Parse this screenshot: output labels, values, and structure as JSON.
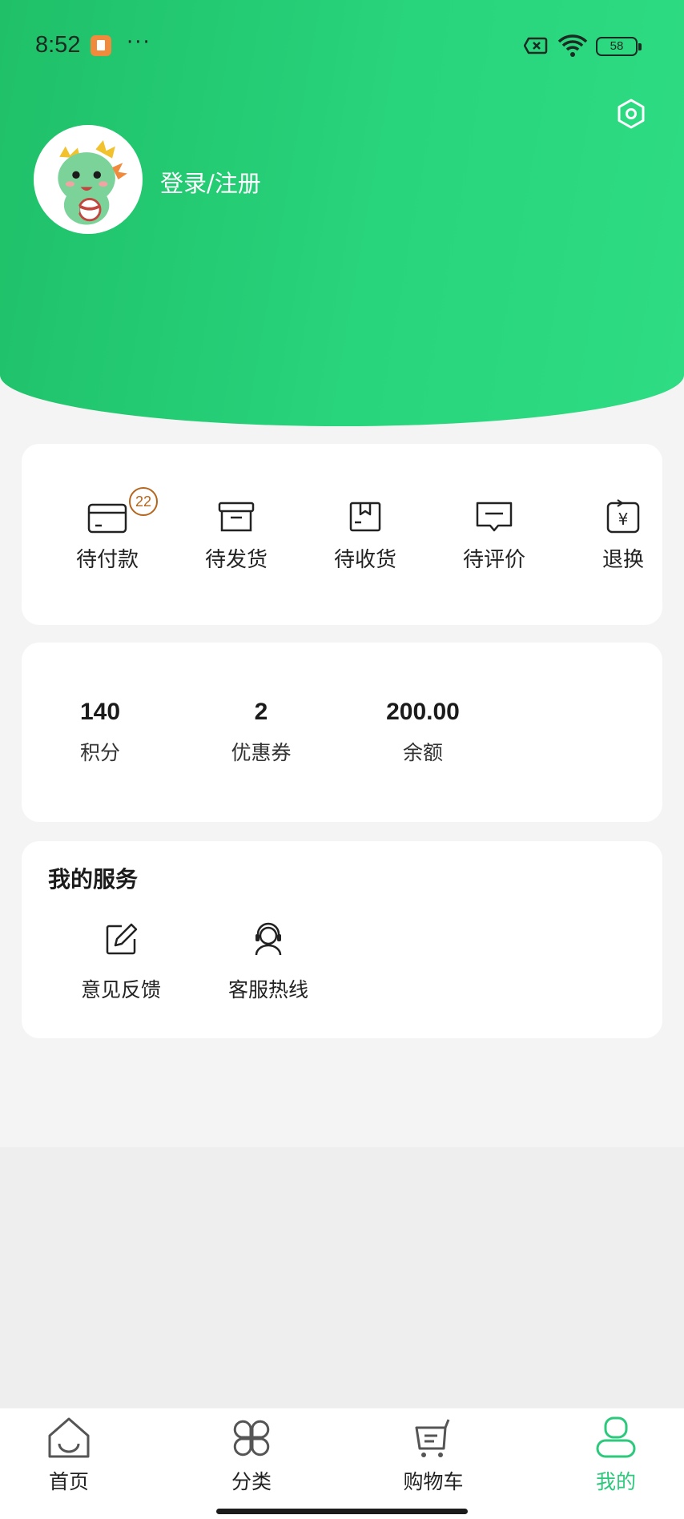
{
  "status_bar": {
    "time": "8:52",
    "dots": "···",
    "battery": "58"
  },
  "profile": {
    "login_label": "登录/注册"
  },
  "orders": [
    {
      "label": "待付款",
      "badge": "22"
    },
    {
      "label": "待发货"
    },
    {
      "label": "待收货"
    },
    {
      "label": "待评价"
    },
    {
      "label": "退换"
    }
  ],
  "assets": [
    {
      "value": "140",
      "label": "积分"
    },
    {
      "value": "2",
      "label": "优惠券"
    },
    {
      "value": "200.00",
      "label": "余额"
    }
  ],
  "services": {
    "title": "我的服务",
    "items": [
      {
        "label": "意见反馈",
        "icon": "edit-icon"
      },
      {
        "label": "客服热线",
        "icon": "customer-service-icon"
      }
    ]
  },
  "tabbar": {
    "items": [
      {
        "label": "首页",
        "icon": "home-icon"
      },
      {
        "label": "分类",
        "icon": "category-icon"
      },
      {
        "label": "购物车",
        "icon": "cart-icon"
      },
      {
        "label": "我的",
        "icon": "profile-icon",
        "active": true
      }
    ]
  },
  "colors": {
    "brand_green": "#28d47c",
    "active_tab": "#2cc97c",
    "badge": "#b5651d"
  }
}
